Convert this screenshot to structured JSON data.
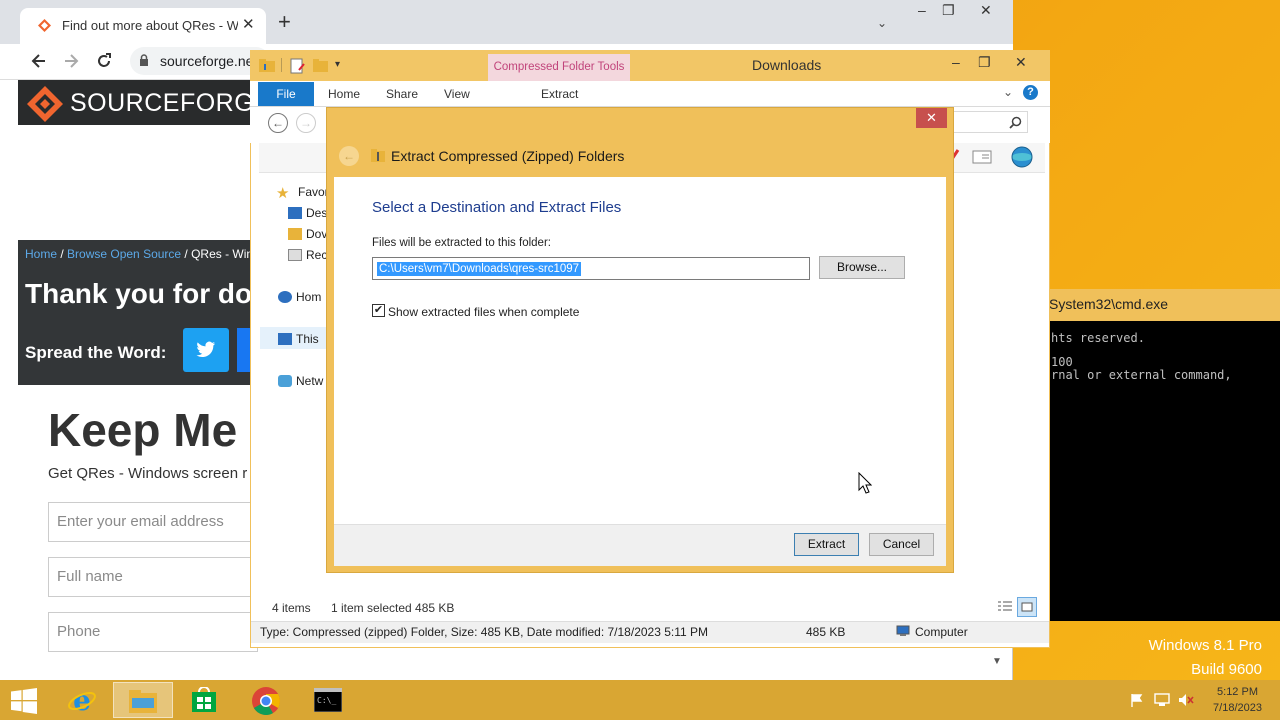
{
  "desktop": {
    "watermark_line1": "Windows 8.1 Pro",
    "watermark_line2": "Build 9600"
  },
  "chrome": {
    "tab_title": "Find out more about QRes - Win",
    "tab_close": "✕",
    "new_tab": "+",
    "address_text": "sourceforge.ne",
    "page": {
      "logo_text": "SOURCEFORGE",
      "breadcrumb_home": "Home",
      "breadcrumb_sep1": " / ",
      "breadcrumb_browse": "Browse Open Source",
      "breadcrumb_rest": " / QRes - Wind",
      "thank_you": "Thank you for do",
      "spread_word": "Spread the Word:",
      "keep_me": "Keep Me",
      "get_qres": "Get QRes - Windows screen r",
      "email_placeholder": "Enter your email address",
      "fullname_placeholder": "Full name",
      "phone_placeholder": "Phone"
    }
  },
  "cmd": {
    "title": "System32\\cmd.exe",
    "lines": [
      "hts reserved.",
      "100",
      "rnal or external command,"
    ]
  },
  "explorer": {
    "context_tools": "Compressed Folder Tools",
    "title": "Downloads",
    "tabs": {
      "file": "File",
      "home": "Home",
      "share": "Share",
      "view": "View",
      "extract": "Extract"
    },
    "nav": {
      "favorites": "Favor",
      "desktop": "Des",
      "downloads": "Dov",
      "recent": "Rec",
      "homegroup": "Hom",
      "this_pc": "This",
      "network": "Netw"
    },
    "status_items": "4 items",
    "status_selected": "1 item selected  485 KB",
    "details_text": "Type: Compressed (zipped) Folder, Size: 485 KB, Date modified: 7/18/2023 5:11 PM",
    "details_size": "485 KB",
    "details_computer": "Computer"
  },
  "dialog": {
    "title": "Extract Compressed (Zipped) Folders",
    "heading": "Select a Destination and Extract Files",
    "label": "Files will be extracted to this folder:",
    "path_value": "C:\\Users\\vm7\\Downloads\\qres-src1097",
    "browse_label": "Browse...",
    "checkbox_label": "Show extracted files when complete",
    "checkbox_checked": true,
    "extract_label": "Extract",
    "cancel_label": "Cancel",
    "close_glyph": "✕"
  },
  "taskbar": {
    "time": "5:12 PM",
    "date": "7/18/2023"
  }
}
